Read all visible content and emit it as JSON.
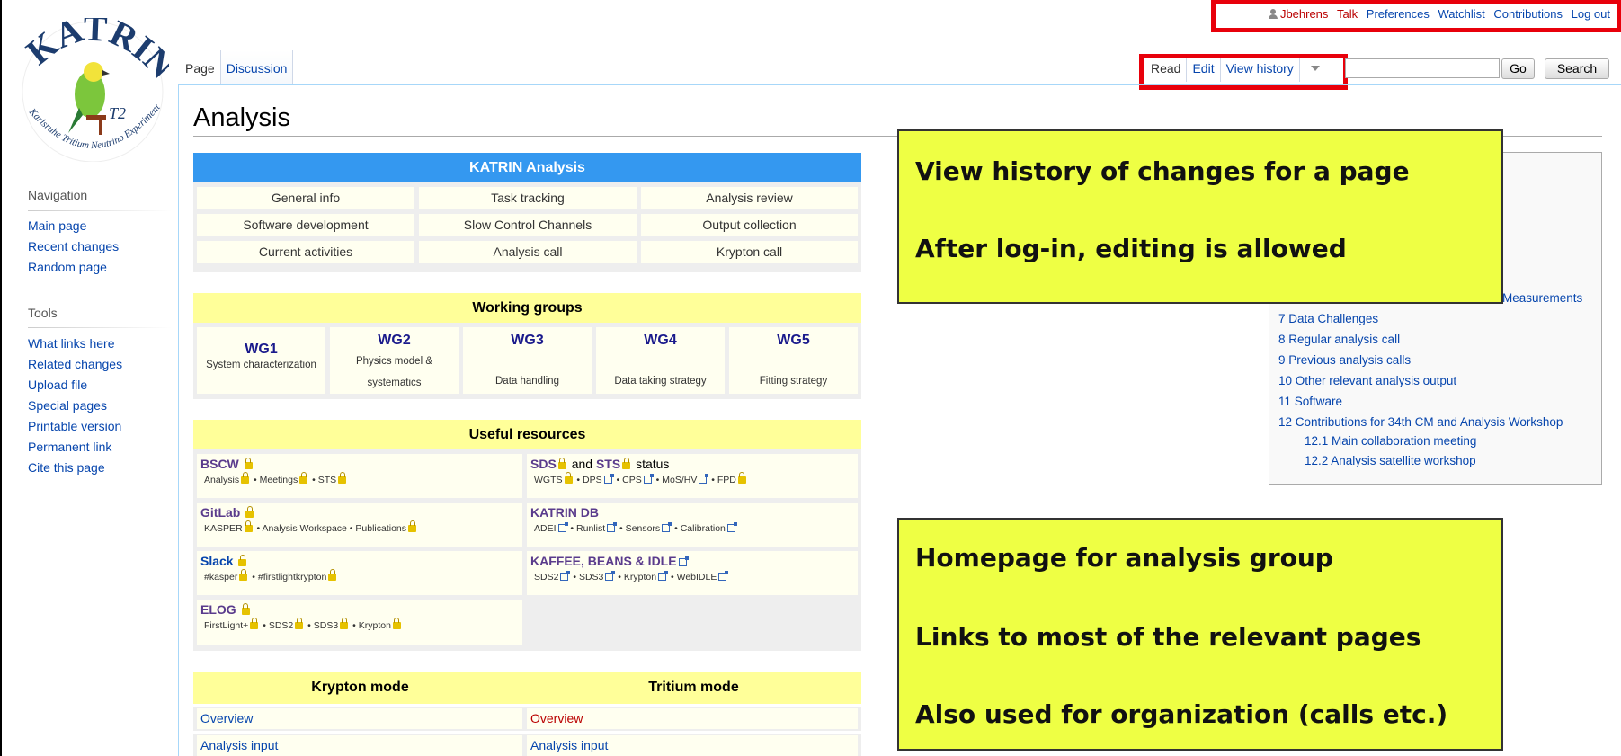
{
  "personal": {
    "user": "Jbehrens",
    "talk": "Talk",
    "preferences": "Preferences",
    "watchlist": "Watchlist",
    "contributions": "Contributions",
    "logout": "Log out"
  },
  "logo": {
    "top_text": "KATRIN",
    "bottom_text": "Karlsruhe Tritium Neutrino Experiment",
    "badge": "T2"
  },
  "sidebar": {
    "nav_heading": "Navigation",
    "nav_items": [
      "Main page",
      "Recent changes",
      "Random page"
    ],
    "tools_heading": "Tools",
    "tool_items": [
      "What links here",
      "Related changes",
      "Upload file",
      "Special pages",
      "Printable version",
      "Permanent link",
      "Cite this page"
    ]
  },
  "tabs": {
    "page": "Page",
    "discussion": "Discussion",
    "read": "Read",
    "edit": "Edit",
    "history": "View history"
  },
  "search": {
    "go": "Go",
    "search": "Search",
    "value": ""
  },
  "page_title": "Analysis",
  "katrin_analysis": {
    "title": "KATRIN Analysis",
    "cells": [
      "General info",
      "Task tracking",
      "Analysis review",
      "Software development",
      "Slow Control Channels",
      "Output collection",
      "Current activities",
      "Analysis call",
      "Krypton call"
    ]
  },
  "working_groups": {
    "title": "Working groups",
    "groups": [
      {
        "name": "WG1",
        "desc": "System characterization"
      },
      {
        "name": "WG2",
        "desc": "Physics model & systematics"
      },
      {
        "name": "WG3",
        "desc": "Data handling"
      },
      {
        "name": "WG4",
        "desc": "Data taking strategy"
      },
      {
        "name": "WG5",
        "desc": "Fitting strategy"
      }
    ]
  },
  "useful_resources": {
    "title": "Useful resources",
    "bscw": {
      "title": "BSCW",
      "links": [
        "Analysis",
        "Meetings",
        "STS"
      ]
    },
    "sds": {
      "title_a": "SDS",
      "title_b": "and",
      "title_c": "STS",
      "title_d": "status",
      "links": [
        "WGTS",
        "DPS",
        "CPS",
        "MoS/HV",
        "FPD"
      ]
    },
    "gitlab": {
      "title": "GitLab",
      "links": [
        "KASPER",
        "Analysis Workspace",
        "Publications"
      ]
    },
    "katrindb": {
      "title": "KATRIN DB",
      "links": [
        "ADEI",
        "Runlist",
        "Sensors",
        "Calibration"
      ]
    },
    "slack": {
      "title": "Slack",
      "links": [
        "#kasper",
        "#firstlightkrypton"
      ]
    },
    "kaffee": {
      "title": "KAFFEE, BEANS & IDLE",
      "links": [
        "SDS2",
        "SDS3",
        "Krypton",
        "WebIDLE"
      ]
    },
    "elog": {
      "title": "ELOG",
      "links": [
        "FirstLight+",
        "SDS2",
        "SDS3",
        "Krypton"
      ]
    }
  },
  "modes": {
    "krypton": "Krypton mode",
    "tritium": "Tritium mode",
    "k_rows": [
      "Overview",
      "Analysis input"
    ],
    "t_rows": [
      "Overview",
      "Analysis input"
    ]
  },
  "toc": {
    "items": [
      "Measurements",
      "7 Data Challenges",
      "8 Regular analysis call",
      "9 Previous analysis calls",
      "10 Other relevant analysis output",
      "11 Software",
      "12 Contributions for 34th CM and Analysis Workshop",
      "12.1 Main collaboration meeting",
      "12.2 Analysis satellite workshop"
    ]
  },
  "callout_top": {
    "line1": "View history of changes for a page",
    "line2": "After log-in, editing is allowed"
  },
  "callout_bottom": {
    "line1": "Homepage for analysis group",
    "line2": "Links to most of the relevant pages",
    "line3": "Also used for organization (calls etc.)"
  },
  "colors": {
    "highlight_box": "#e8000b",
    "callout_bg": "#eeff44",
    "table_header_blue": "#3498f0",
    "table_header_yellow": "#ffff99",
    "link": "#0645ad",
    "redlink": "#ba0000"
  }
}
